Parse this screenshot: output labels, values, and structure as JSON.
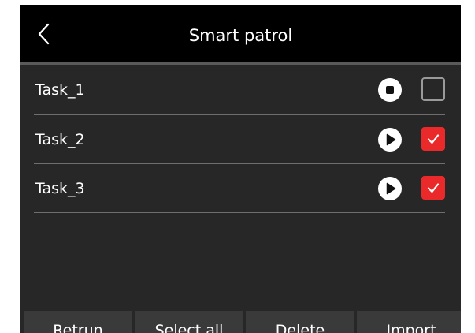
{
  "header": {
    "back_icon": "chevron-left-icon",
    "title": "Smart patrol"
  },
  "tasks": [
    {
      "label": "Task_1",
      "action_icon": "stop-icon",
      "checked": false
    },
    {
      "label": "Task_2",
      "action_icon": "play-icon",
      "checked": true
    },
    {
      "label": "Task_3",
      "action_icon": "play-icon",
      "checked": true
    }
  ],
  "footer": {
    "return_label": "Retrun",
    "select_all_label": "Select all",
    "delete_label": "Delete",
    "import_label": "Import"
  },
  "colors": {
    "header_bg": "#000000",
    "screen_bg": "#272727",
    "checkbox_checked": "#ea2a2a",
    "footer_button_bg": "#3a3a3a"
  }
}
